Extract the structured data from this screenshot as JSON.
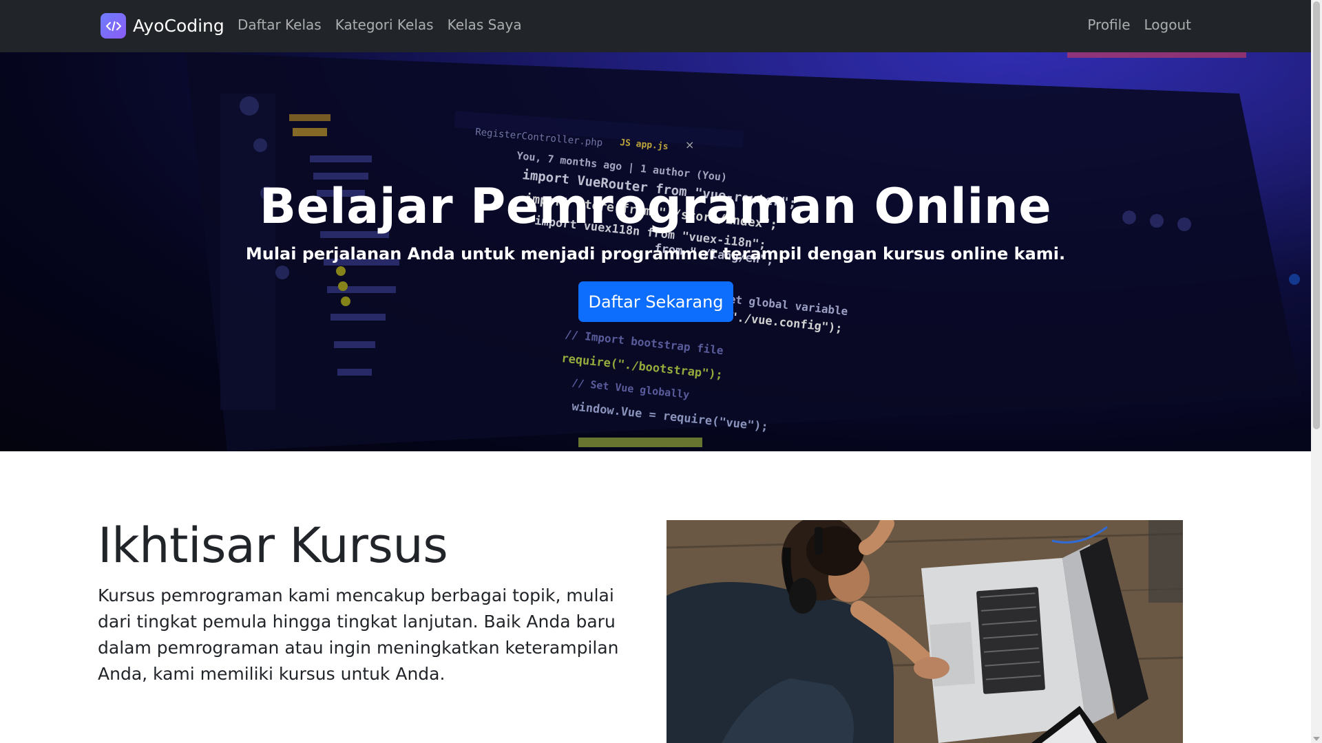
{
  "navbar": {
    "brand": "AyoCoding",
    "links_left": [
      "Daftar Kelas",
      "Kategori Kelas",
      "Kelas Saya"
    ],
    "links_right": [
      "Profile",
      "Logout"
    ]
  },
  "hero": {
    "title": "Belajar Pemrograman Online",
    "subtitle": "Mulai perjalanan Anda untuk menjadi programmer terampil dengan kursus online kami.",
    "cta_label": "Daftar Sekarang",
    "code_snippets": [
      "RegisterController.php",
      "JS app.js",
      "You, 7 months ago | 1 author (You)",
      "import VueRouter from \"vue-router\";",
      "import store from \"./store/index\";",
      "import vuex118n from \"vuex-i18n\";",
      "from \"./lang/en\";",
      "// Set global variable",
      "\"./vue.config\");",
      "// Import bootstrap file",
      "require(\"./bootstrap\");",
      "// Set Vue globally",
      "window.Vue = require(\"vue\");"
    ]
  },
  "overview": {
    "title": "Ikhtisar Kursus",
    "text": "Kursus pemrograman kami mencakup berbagai topik, mulai dari tingkat pemula hingga tingkat lanjutan. Baik Anda baru dalam pemrograman atau ingin meningkatkan keterampilan Anda, kami memiliki kursus untuk Anda."
  },
  "colors": {
    "navbar_bg": "#212529",
    "primary": "#0d6efd",
    "brand_logo": "#7b6cf6"
  }
}
